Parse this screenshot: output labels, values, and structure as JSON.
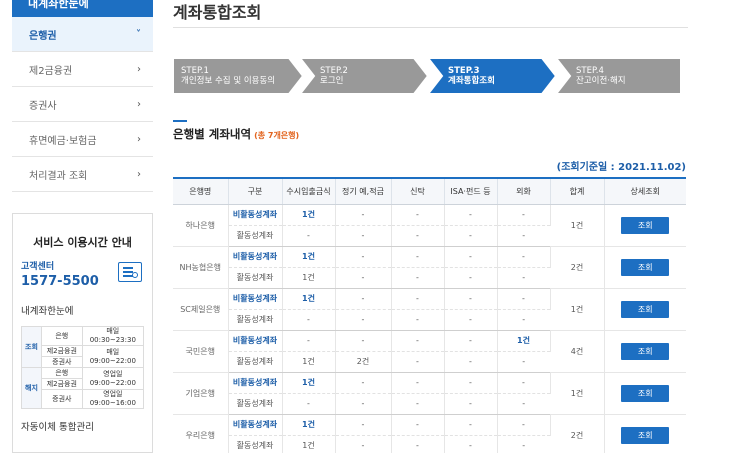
{
  "sidebar": {
    "top_label": "내계좌한눈에",
    "items": [
      {
        "label": "은행권",
        "active": true,
        "chevron": "˅"
      },
      {
        "label": "제2금융권",
        "active": false,
        "chevron": "›"
      },
      {
        "label": "증권사",
        "active": false,
        "chevron": "›"
      },
      {
        "label": "휴면예금·보험금",
        "active": false,
        "chevron": "›"
      },
      {
        "label": "처리결과 조회",
        "active": false,
        "chevron": "›"
      }
    ],
    "info": {
      "title": "서비스 이용시간 안내",
      "cc_label": "고객센터",
      "cc_number": "1577-5500",
      "sub_title": "내계좌한눈에",
      "schedule": {
        "inquiry_label": "조회",
        "cancel_label": "해지",
        "rows": [
          {
            "org": "은행",
            "time": "매일\n00:30~23:30"
          },
          {
            "org": "제2금융권",
            "time": "매일"
          },
          {
            "org": "증권사",
            "time": "09:00~22:00"
          },
          {
            "org": "은행",
            "time": "영업일\n09:00~22:00"
          },
          {
            "org": "제2금융권",
            "time": ""
          },
          {
            "org": "증권사",
            "time": "영업일\n09:00~16:00"
          }
        ]
      },
      "bottom": "자동이체 통합관리"
    }
  },
  "main": {
    "title": "계좌통합조회",
    "steps": [
      {
        "no": "STEP.1",
        "label": "개인정보 수집 및 이용동의",
        "active": false
      },
      {
        "no": "STEP.2",
        "label": "로그인",
        "active": false
      },
      {
        "no": "STEP.3",
        "label": "계좌통합조회",
        "active": true
      },
      {
        "no": "STEP.4",
        "label": "잔고이전·해지",
        "active": false
      }
    ],
    "section_title": "은행별 계좌내역",
    "section_count": "(총 7개은행)",
    "as_of": "(조회기준일 : 2021.11.02)",
    "columns": [
      "은행명",
      "구분",
      "수시입출금식",
      "정기 예,적금",
      "신탁",
      "ISA·펀드 등",
      "외화",
      "합계",
      "상세조회"
    ],
    "button_label": "조회",
    "banks": [
      {
        "name": "하나은행",
        "total": "1건",
        "rows": [
          {
            "kind": "비활동성계좌",
            "vals": [
              "1건",
              "-",
              "-",
              "-",
              "-"
            ]
          },
          {
            "kind": "활동성계좌",
            "vals": [
              "-",
              "-",
              "-",
              "-",
              "-"
            ]
          }
        ]
      },
      {
        "name": "NH농협은행",
        "total": "2건",
        "rows": [
          {
            "kind": "비활동성계좌",
            "vals": [
              "1건",
              "-",
              "-",
              "-",
              "-"
            ]
          },
          {
            "kind": "활동성계좌",
            "vals": [
              "1건",
              "-",
              "-",
              "-",
              "-"
            ]
          }
        ]
      },
      {
        "name": "SC제일은행",
        "total": "1건",
        "rows": [
          {
            "kind": "비활동성계좌",
            "vals": [
              "1건",
              "-",
              "-",
              "-",
              "-"
            ]
          },
          {
            "kind": "활동성계좌",
            "vals": [
              "-",
              "-",
              "-",
              "-",
              "-"
            ]
          }
        ]
      },
      {
        "name": "국민은행",
        "total": "4건",
        "rows": [
          {
            "kind": "비활동성계좌",
            "vals": [
              "-",
              "-",
              "-",
              "-",
              "1건"
            ]
          },
          {
            "kind": "활동성계좌",
            "vals": [
              "1건",
              "2건",
              "-",
              "-",
              "-"
            ]
          }
        ]
      },
      {
        "name": "기업은행",
        "total": "1건",
        "rows": [
          {
            "kind": "비활동성계좌",
            "vals": [
              "1건",
              "-",
              "-",
              "-",
              "-"
            ]
          },
          {
            "kind": "활동성계좌",
            "vals": [
              "-",
              "-",
              "-",
              "-",
              "-"
            ]
          }
        ]
      },
      {
        "name": "우리은행",
        "total": "2건",
        "rows": [
          {
            "kind": "비활동성계좌",
            "vals": [
              "1건",
              "-",
              "-",
              "-",
              "-"
            ]
          },
          {
            "kind": "활동성계좌",
            "vals": [
              "1건",
              "-",
              "-",
              "-",
              "-"
            ]
          }
        ]
      }
    ]
  },
  "colors": {
    "accent": "#1d6fc2",
    "step_inactive": "#999999",
    "count": "#e2631d"
  }
}
